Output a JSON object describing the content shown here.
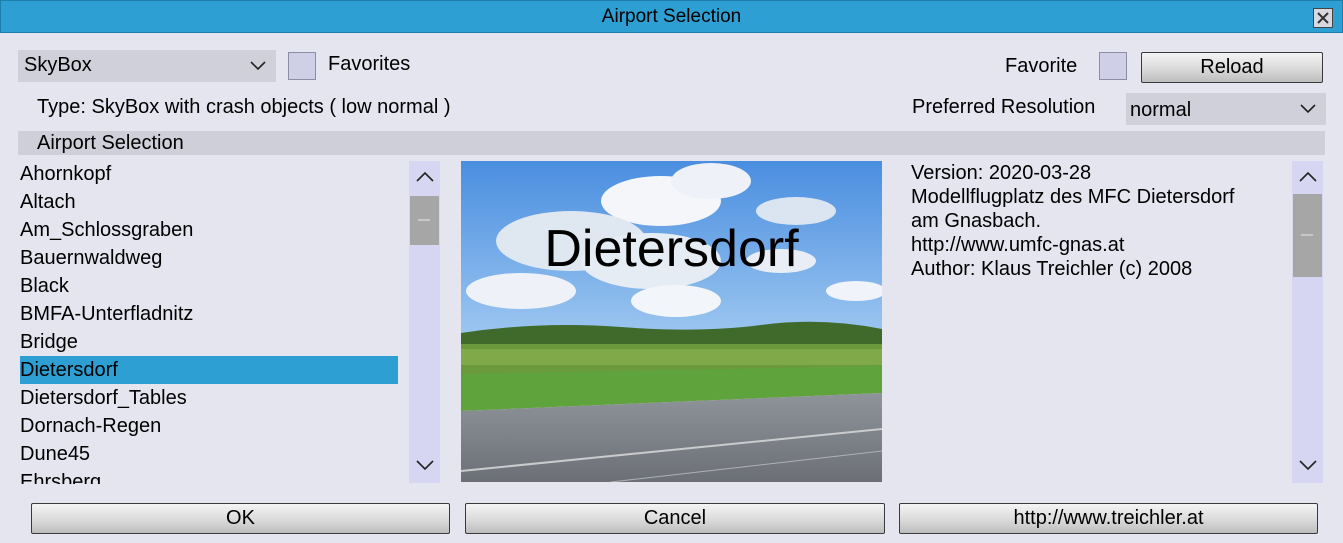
{
  "window": {
    "title": "Airport Selection"
  },
  "toolbar": {
    "scenery_type_selected": "SkyBox",
    "favorites_label": "Favorites",
    "favorite_label": "Favorite",
    "reload_label": "Reload"
  },
  "info_row": {
    "type_text": "Type: SkyBox with crash objects ( low normal )",
    "preferred_resolution_label": "Preferred Resolution",
    "preferred_resolution_value": "normal"
  },
  "section": {
    "title": "Airport Selection"
  },
  "airports": [
    "Ahornkopf",
    "Altach",
    "Am_Schlossgraben",
    "Bauernwaldweg",
    "Black",
    "BMFA-Unterfladnitz",
    "Bridge",
    "Dietersdorf",
    "Dietersdorf_Tables",
    "Dornach-Regen",
    "Dune45",
    "Ehrsberg"
  ],
  "selected_airport": "Dietersdorf",
  "preview": {
    "title": "Dietersdorf"
  },
  "info": {
    "lines": [
      "Version: 2020-03-28",
      "Modellflugplatz des MFC Dietersdorf",
      "am Gnasbach.",
      "http://www.umfc-gnas.at",
      "Author: Klaus Treichler (c) 2008"
    ]
  },
  "buttons": {
    "ok": "OK",
    "cancel": "Cancel",
    "website": "http://www.treichler.at"
  },
  "colors": {
    "accent": "#2e9fd3",
    "background": "#e5e5ef",
    "scroll_track": "#d6d6f2"
  },
  "icons": {
    "close": "close-icon",
    "dropdown": "chevron-down-icon",
    "scroll_up": "chevron-up-icon",
    "scroll_down": "chevron-down-icon"
  }
}
